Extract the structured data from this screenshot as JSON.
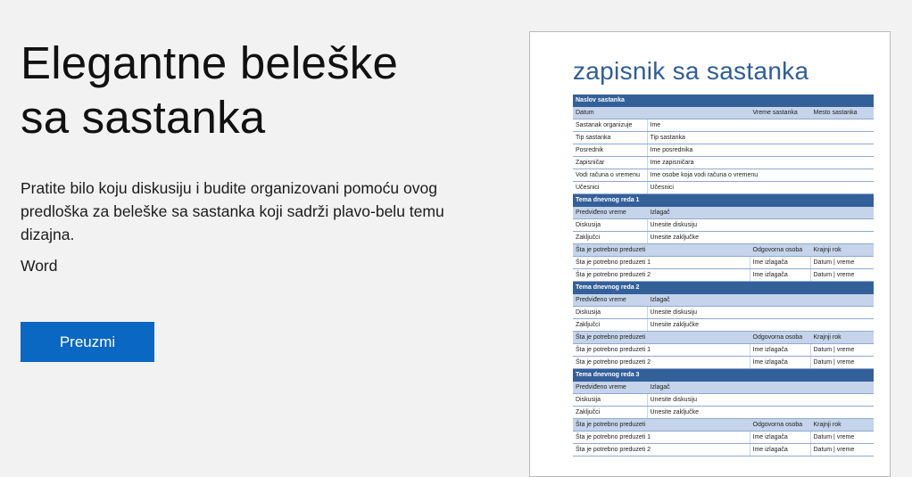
{
  "hero": {
    "title_line1": "Elegantne beleške",
    "title_line2": "sa sastanka",
    "description": "Pratite bilo koju diskusiju i budite organizovani pomoću ovog predloška za beleške sa sastanka koji sadrži plavo-belu temu dizajna.",
    "app_name": "Word",
    "download_label": "Preuzmi"
  },
  "preview": {
    "doc_title": "zapisnik sa sastanka",
    "meeting_title": "Naslov sastanka",
    "date_label": "Datum",
    "time_label": "Vreme sastanka",
    "place_label": "Mesto sastanka",
    "info_rows": [
      {
        "label": "Sastanak organizuje",
        "value": "Ime"
      },
      {
        "label": "Tip sastanka",
        "value": "Tip sastanka"
      },
      {
        "label": "Posrednik",
        "value": "Ime posrednika"
      },
      {
        "label": "Zapisničar",
        "value": "Ime zapisničara"
      },
      {
        "label": "Vodi računa o vremenu",
        "value": "Ime osobe koja vodi računa o vremenu"
      },
      {
        "label": "Učesnici",
        "value": "Učesnici"
      }
    ],
    "topics": [
      {
        "header": "Tema dnevnog reda 1",
        "time_label": "Predviđeno vreme",
        "presenter_label": "Izlagač",
        "discussion_label": "Diskusija",
        "discussion_value": "Unesite diskusiju",
        "conclusions_label": "Zaključci",
        "conclusions_value": "Unesite zaključke",
        "actions_label": "Šta je potrebno preduzeti",
        "responsible_label": "Odgovorna osoba",
        "deadline_label": "Krajnji rok",
        "actions": [
          {
            "item": "Šta je potrebno preduzeti 1",
            "person": "Ime izlagača",
            "deadline": "Datum | vreme"
          },
          {
            "item": "Šta je potrebno preduzeti 2",
            "person": "Ime izlagača",
            "deadline": "Datum | vreme"
          }
        ]
      },
      {
        "header": "Tema dnevnog reda 2",
        "time_label": "Predviđeno vreme",
        "presenter_label": "Izlagač",
        "discussion_label": "Diskusija",
        "discussion_value": "Unesite diskusiju",
        "conclusions_label": "Zaključci",
        "conclusions_value": "Unesite zaključke",
        "actions_label": "Šta je potrebno preduzeti",
        "responsible_label": "Odgovorna osoba",
        "deadline_label": "Krajnji rok",
        "actions": [
          {
            "item": "Šta je potrebno preduzeti 1",
            "person": "Ime izlagača",
            "deadline": "Datum | vreme"
          },
          {
            "item": "Šta je potrebno preduzeti 2",
            "person": "Ime izlagača",
            "deadline": "Datum | vreme"
          }
        ]
      },
      {
        "header": "Tema dnevnog reda 3",
        "time_label": "Predviđeno vreme",
        "presenter_label": "Izlagač",
        "discussion_label": "Diskusija",
        "discussion_value": "Unesite diskusiju",
        "conclusions_label": "Zaključci",
        "conclusions_value": "Unesite zaključke",
        "actions_label": "Šta je potrebno preduzeti",
        "responsible_label": "Odgovorna osoba",
        "deadline_label": "Krajnji rok",
        "actions": [
          {
            "item": "Šta je potrebno preduzeti 1",
            "person": "Ime izlagača",
            "deadline": "Datum | vreme"
          },
          {
            "item": "Šta je potrebno preduzeti 2",
            "person": "Ime izlagača",
            "deadline": "Datum | vreme"
          }
        ]
      }
    ]
  },
  "colors": {
    "accent_button": "#0a67c2",
    "doc_title": "#2f5e99",
    "table_header": "#34609a",
    "table_subheader": "#c5d4ea"
  }
}
